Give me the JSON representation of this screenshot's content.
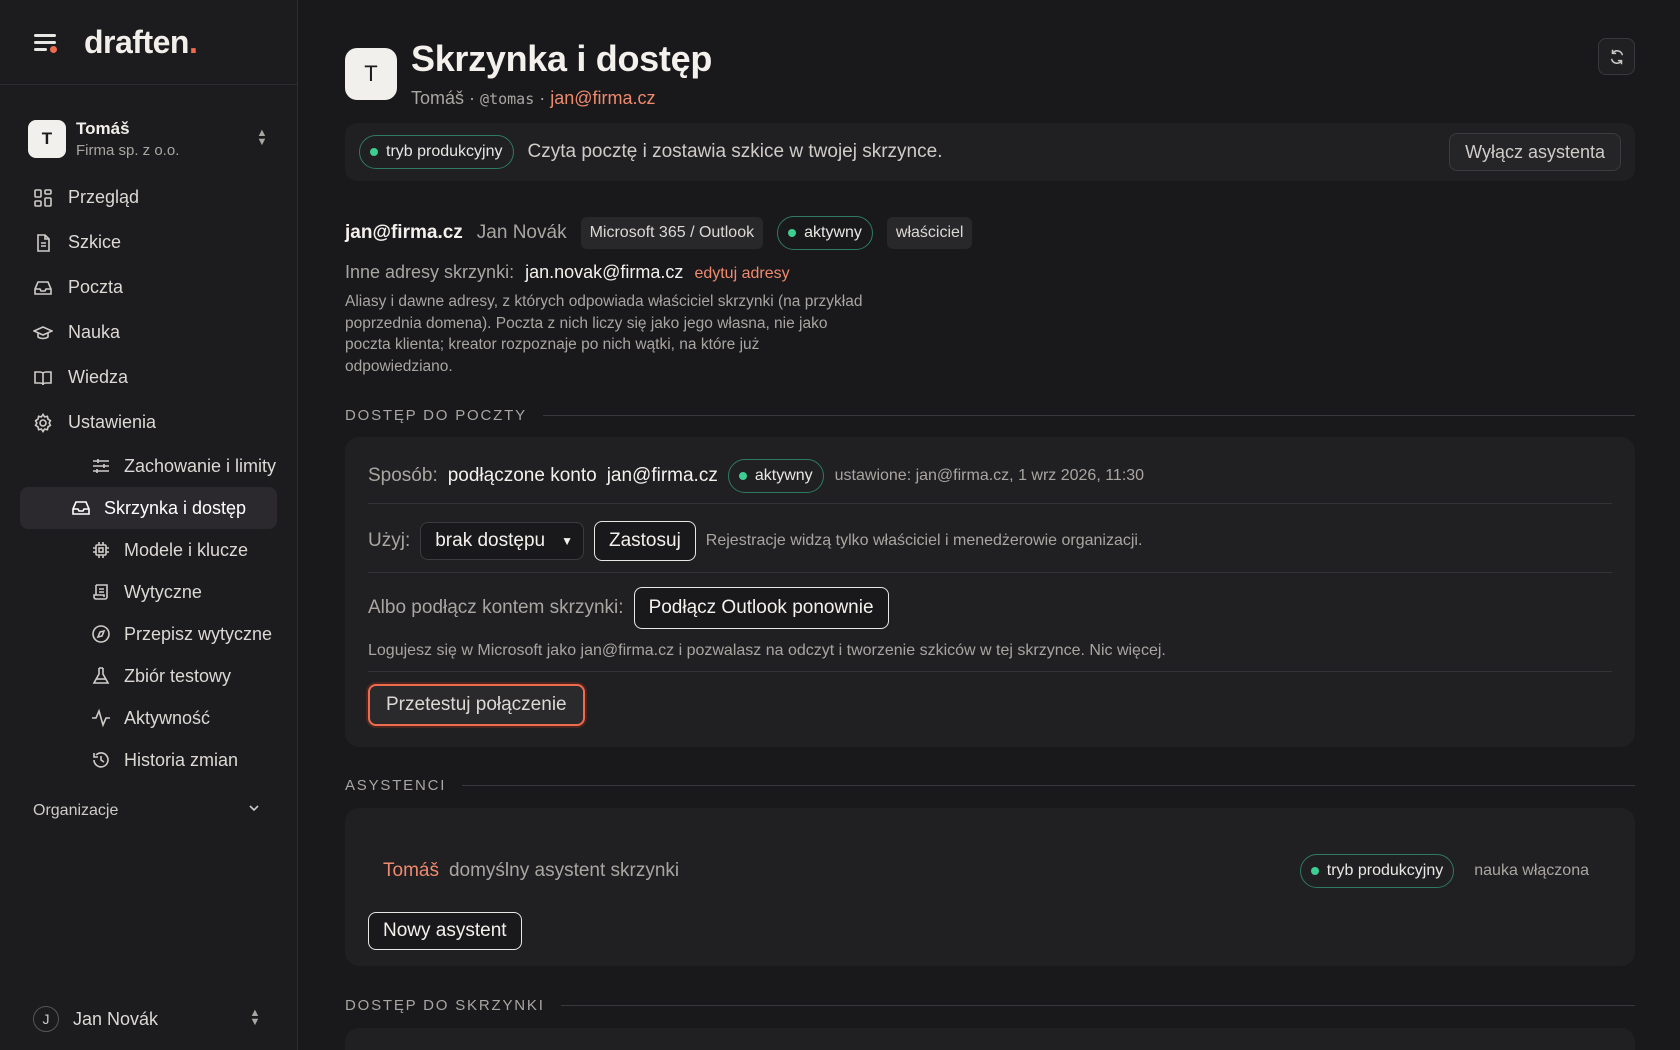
{
  "brand": {
    "name": "draften",
    "dot": "."
  },
  "workspace": {
    "initial": "T",
    "name": "Tomáš",
    "org": "Firma sp. z o.o."
  },
  "nav": {
    "items": [
      {
        "label": "Przegląd",
        "icon": "grid-icon"
      },
      {
        "label": "Szkice",
        "icon": "document-icon"
      },
      {
        "label": "Poczta",
        "icon": "inbox-icon"
      },
      {
        "label": "Nauka",
        "icon": "graduation-cap-icon"
      },
      {
        "label": "Wiedza",
        "icon": "book-icon"
      },
      {
        "label": "Ustawienia",
        "icon": "gear-icon"
      }
    ],
    "subitems": [
      {
        "label": "Zachowanie i limity",
        "icon": "sliders-icon"
      },
      {
        "label": "Skrzynka i dostęp",
        "icon": "inbox-icon"
      },
      {
        "label": "Modele i klucze",
        "icon": "chip-icon"
      },
      {
        "label": "Wytyczne",
        "icon": "scroll-icon"
      },
      {
        "label": "Przepisz wytyczne",
        "icon": "compass-icon"
      },
      {
        "label": "Zbiór testowy",
        "icon": "flask-icon"
      },
      {
        "label": "Aktywność",
        "icon": "activity-icon"
      },
      {
        "label": "Historia zmian",
        "icon": "history-icon"
      }
    ],
    "org_label": "Organizacje"
  },
  "user": {
    "initial": "J",
    "name": "Jan Novák"
  },
  "header": {
    "initial": "T",
    "title": "Skrzynka i dostęp",
    "sub_name": "Tomáš",
    "sep": "·",
    "handle": "@tomas",
    "email": "jan@firma.cz"
  },
  "banner": {
    "mode": "tryb produkcyjny",
    "desc": "Czyta pocztę i zostawia szkice w twojej skrzynce.",
    "button": "Wyłącz asystenta"
  },
  "account": {
    "email": "jan@firma.cz",
    "name": "Jan Novák",
    "provider": "Microsoft 365 / Outlook",
    "status": "aktywny",
    "role": "właściciel"
  },
  "aliases": {
    "label": "Inne adresy skrzynki:",
    "value": "jan.novak@firma.cz",
    "edit": "edytuj adresy",
    "help": "Aliasy i dawne adresy, z których odpowiada właściciel skrzynki (na przykład poprzednia domena). Poczta z nich liczy się jako jego własna, nie jako poczta klienta; kreator rozpoznaje po nich wątki, na które już odpowiedziano."
  },
  "mail_access": {
    "section": "DOSTĘP DO POCZTY",
    "method_label": "Sposób:",
    "method_value": "podłączone konto",
    "method_email": "jan@firma.cz",
    "status": "aktywny",
    "set_info": "ustawione: jan@firma.cz, 1 wrz 2026, 11:30",
    "use_label": "Użyj:",
    "use_selected": "brak dostępu",
    "apply": "Zastosuj",
    "use_note": "Rejestracje widzą tylko właściciel i menedżerowie organizacji.",
    "connect_label": "Albo podłącz kontem skrzynki:",
    "connect_button": "Podłącz Outlook ponownie",
    "connect_note": "Logujesz się w Microsoft jako jan@firma.cz i pozwalasz na odczyt i tworzenie szkiców w tej skrzynce. Nic więcej.",
    "test_button": "Przetestuj połączenie"
  },
  "assistants": {
    "section": "ASYSTENCI",
    "name": "Tomáš",
    "desc": "domyślny asystent skrzynki",
    "mode": "tryb produkcyjny",
    "learning": "nauka włączona",
    "new_button": "Nowy asystent"
  },
  "box_access": {
    "section": "DOSTĘP DO SKRZYNKI"
  },
  "colors": {
    "accent": "#ef6b4e",
    "status_green": "#3ccf91",
    "background": "#19181b"
  }
}
